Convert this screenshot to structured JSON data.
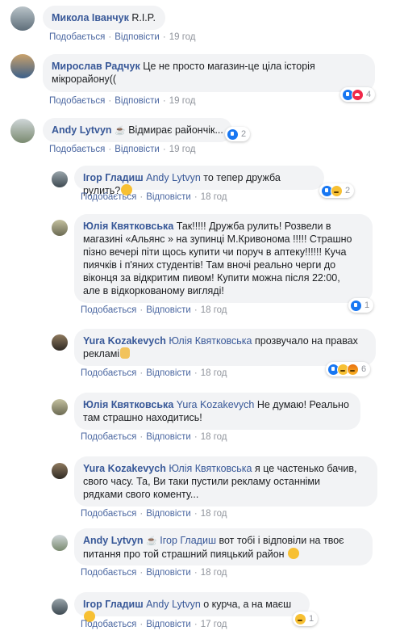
{
  "actions": {
    "like": "Подобається",
    "reply": "Відповісти"
  },
  "comments": [
    {
      "author": "Микола Іванчук",
      "text": " R.I.P.",
      "time": "19 год"
    },
    {
      "author": "Мирослав Радчук",
      "text1": " Це не просто магазин-це ціла історія",
      "text2": "мікрорайону((",
      "time": "19 год",
      "reactions_count": "4"
    },
    {
      "author": "Andy Lytvyn",
      "badge": "☕",
      "text": " Відмирає райончік...",
      "time": "19 год",
      "reactions_count": "2"
    },
    {
      "author": "Ігор Гладиш",
      "mention": "Andy Lytvyn",
      "text": " то тепер дружба рулить?",
      "time": "18 год",
      "reactions_count": "2"
    },
    {
      "author": "Юлія Квятковська",
      "lines": [
        " Так!!!!! Дружба рулить! Розвели в",
        "магазині «Альянс » на зупинці М.Кривонома !!!!! Страшно",
        "пізно вечері піти щось купити чи поруч в аптеку!!!!!! Куча",
        "пиячків і п'яних студентів! Там вночі реально черги до",
        "віконця за відкритим пивом! Купити можна після 22:00,",
        "але в відкоркованому вигляді!"
      ],
      "time": "18 год",
      "reactions_count": "1"
    },
    {
      "author": "Yura Kozakevych",
      "mention": "Юлія Квятковська",
      "text1": " прозвучало на правах",
      "text2": "рекламі",
      "time": "18 год",
      "reactions_count": "6"
    },
    {
      "author": "Юлія Квятковська",
      "mention": "Yura Kozakevych",
      "text1": " Не думаю! Реально",
      "text2": "там страшно находитись!",
      "time": "18 год"
    },
    {
      "author": "Yura Kozakevych",
      "mention": "Юлія Квятковська",
      "lines": [
        " я це частенько бачив,",
        "свого часу. Та, Ви таки пустили рекламу останніми",
        "рядками свого коменту..."
      ],
      "time": "18 год"
    },
    {
      "author": "Andy Lytvyn",
      "badge": "☕",
      "mention": "Ігор Гладиш",
      "text1": " вот тобі і відповіли на твоє",
      "text2": "питання про той страшний пияцький район",
      "time": "18 год"
    },
    {
      "author": "Ігор Гладиш",
      "mention": "Andy Lytvyn",
      "text": " о курча, а на маєш",
      "time": "17 год",
      "reactions_count": "1"
    }
  ]
}
